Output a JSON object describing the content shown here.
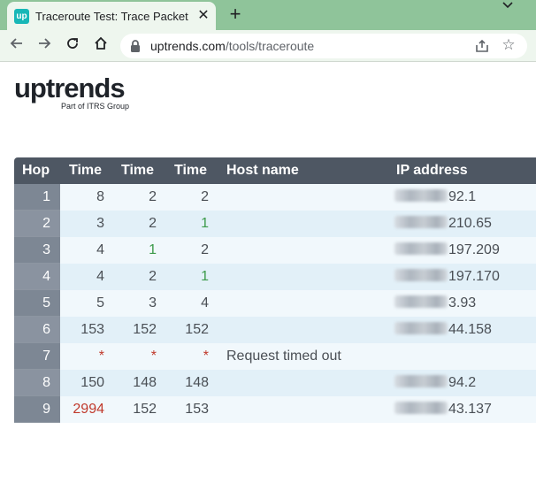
{
  "browser": {
    "tab_title": "Traceroute Test: Trace Packet Path",
    "favicon_text": "up",
    "url_host": "uptrends.com",
    "url_path": "/tools/traceroute"
  },
  "logo": {
    "wordmark": "uptrends",
    "subtitle": "Part of ITRS Group"
  },
  "table": {
    "headers": {
      "hop": "Hop",
      "time1": "Time",
      "time2": "Time",
      "time3": "Time",
      "host": "Host name",
      "ip": "IP address"
    },
    "rows": [
      {
        "hop": "1",
        "t1": "8",
        "t2": "2",
        "t3": "2",
        "host": "",
        "ip": "92.1",
        "c1": "",
        "c2": "",
        "c3": ""
      },
      {
        "hop": "2",
        "t1": "3",
        "t2": "2",
        "t3": "1",
        "host": "",
        "ip": "210.65",
        "c1": "",
        "c2": "",
        "c3": "green"
      },
      {
        "hop": "3",
        "t1": "4",
        "t2": "1",
        "t3": "2",
        "host": "",
        "ip": "197.209",
        "c1": "",
        "c2": "green",
        "c3": ""
      },
      {
        "hop": "4",
        "t1": "4",
        "t2": "2",
        "t3": "1",
        "host": "",
        "ip": "197.170",
        "c1": "",
        "c2": "",
        "c3": "green"
      },
      {
        "hop": "5",
        "t1": "5",
        "t2": "3",
        "t3": "4",
        "host": "",
        "ip": "3.93",
        "c1": "",
        "c2": "",
        "c3": ""
      },
      {
        "hop": "6",
        "t1": "153",
        "t2": "152",
        "t3": "152",
        "host": "",
        "ip": "44.158",
        "c1": "",
        "c2": "",
        "c3": ""
      },
      {
        "hop": "7",
        "t1": "*",
        "t2": "*",
        "t3": "*",
        "host": "Request timed out",
        "ip": "",
        "c1": "red",
        "c2": "red",
        "c3": "red"
      },
      {
        "hop": "8",
        "t1": "150",
        "t2": "148",
        "t3": "148",
        "host": "",
        "ip": "94.2",
        "c1": "",
        "c2": "",
        "c3": ""
      },
      {
        "hop": "9",
        "t1": "2994",
        "t2": "152",
        "t3": "153",
        "host": "",
        "ip": "43.137",
        "c1": "red",
        "c2": "",
        "c3": ""
      }
    ]
  },
  "colors": {
    "tabstrip": "#8fc49a",
    "header_bg": "#4e5763",
    "hop_bg": "#7d8794",
    "fast": "#3c9a4a",
    "slow": "#c0392b"
  }
}
